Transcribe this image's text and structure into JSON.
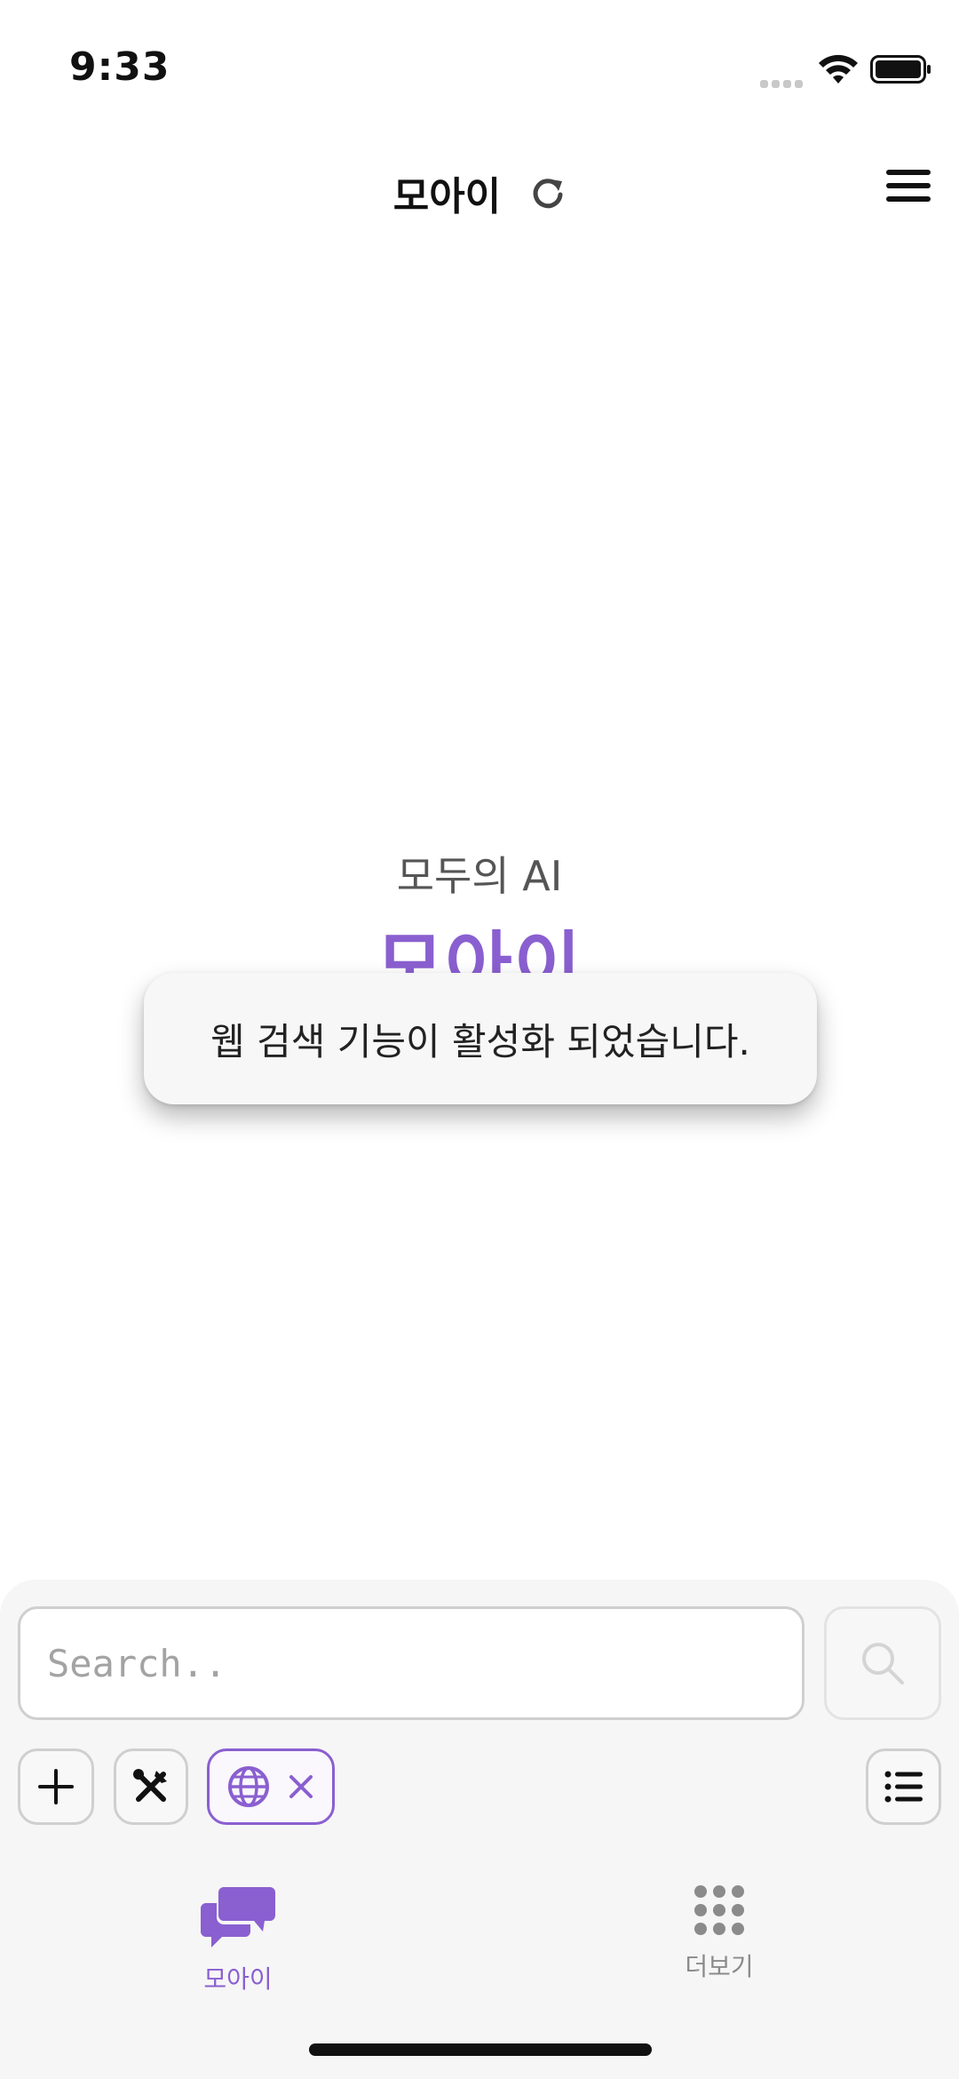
{
  "status_bar": {
    "time": "9:33"
  },
  "header": {
    "title": "모아이"
  },
  "hero": {
    "subtitle": "모두의 AI",
    "title": "모아이"
  },
  "toast": {
    "message": "웹 검색 기능이 활성화 되었습니다."
  },
  "composer": {
    "placeholder": "Search.."
  },
  "tab_bar": {
    "items": [
      {
        "label": "모아이",
        "active": true
      },
      {
        "label": "더보기",
        "active": false
      }
    ]
  },
  "colors": {
    "accent": "#8a5fd0",
    "inactive": "#8b8b8b"
  },
  "icons": [
    "refresh-icon",
    "hamburger-menu-icon",
    "search-icon",
    "plus-icon",
    "tools-icon",
    "globe-icon",
    "close-icon",
    "list-icon",
    "chat-bubbles-icon",
    "grid-dots-icon"
  ]
}
